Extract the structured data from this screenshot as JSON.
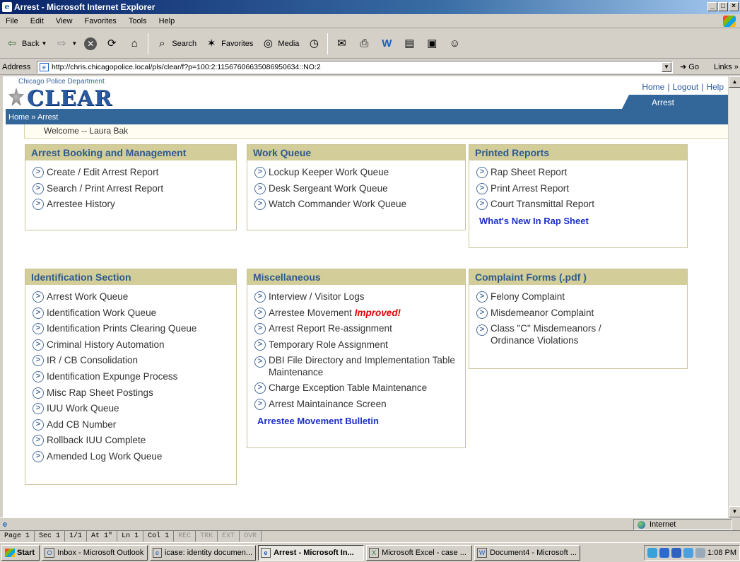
{
  "window": {
    "title": "Arrest - Microsoft Internet Explorer",
    "buttons": [
      "_",
      "□",
      "×"
    ]
  },
  "menu": [
    "File",
    "Edit",
    "View",
    "Favorites",
    "Tools",
    "Help"
  ],
  "toolbar": {
    "back": "Back",
    "search": "Search",
    "favorites": "Favorites",
    "media": "Media"
  },
  "address": {
    "label": "Address",
    "url": "http://chris.chicagopolice.local/pls/clear/f?p=100:2:11567606635086950634::NO:2",
    "go": "Go",
    "links": "Links"
  },
  "page": {
    "dept": "Chicago Police Department",
    "logo": "CLEAR",
    "toplinks": [
      "Home",
      "|",
      "Logout",
      "|",
      "Help"
    ],
    "tab": "Arrest",
    "breadcrumb": "Home » Arrest",
    "welcome": "Welcome -- Laura Bak",
    "panels": [
      {
        "title": "Arrest Booking and Management",
        "items": [
          "Create / Edit Arrest Report",
          "Search / Print Arrest Report",
          "Arrestee History"
        ]
      },
      {
        "title": "Work Queue",
        "items": [
          "Lockup Keeper Work Queue",
          "Desk Sergeant Work Queue",
          "Watch Commander Work Queue"
        ]
      },
      {
        "title": "Printed Reports",
        "items": [
          "Rap Sheet Report",
          "Print Arrest Report",
          "Court Transmittal Report"
        ],
        "extra": "What's New In Rap Sheet"
      },
      {
        "title": "Identification Section",
        "items": [
          "Arrest Work Queue",
          "Identification Work Queue",
          "Identification Prints Clearing Queue",
          "Criminal History Automation",
          "IR / CB Consolidation",
          "Identification Expunge Process",
          "Misc Rap Sheet Postings",
          "IUU Work Queue",
          "Add CB Number",
          "Rollback IUU Complete",
          "Amended Log Work Queue"
        ]
      },
      {
        "title": "Miscellaneous",
        "items": [
          "Interview / Visitor Logs",
          "Arrestee Movement",
          "Arrest Report Re-assignment",
          "Temporary Role Assignment",
          "DBI File Directory and Implementation Table Maintenance",
          "Charge Exception Table Maintenance",
          "Arrest Maintainance Screen"
        ],
        "badge": "Improved!",
        "extra": "Arrestee Movement Bulletin"
      },
      {
        "title": "Complaint Forms (.pdf )",
        "items": [
          "Felony Complaint",
          "Misdemeanor Complaint",
          "Class \"C\" Misdemeanors / Ordinance Violations"
        ]
      }
    ]
  },
  "status": {
    "zone": "Internet",
    "word": [
      "Page 1",
      "Sec 1",
      "1/1",
      "At 1\"",
      "Ln 1",
      "Col 1",
      "REC",
      "TRK",
      "EXT",
      "OVR"
    ]
  },
  "taskbar": {
    "start": "Start",
    "tasks": [
      "Inbox - Microsoft Outlook",
      "icase: identity documen...",
      "Arrest - Microsoft In...",
      "Microsoft Excel - case ...",
      "Document4 - Microsoft ..."
    ],
    "time": "1:08 PM"
  }
}
